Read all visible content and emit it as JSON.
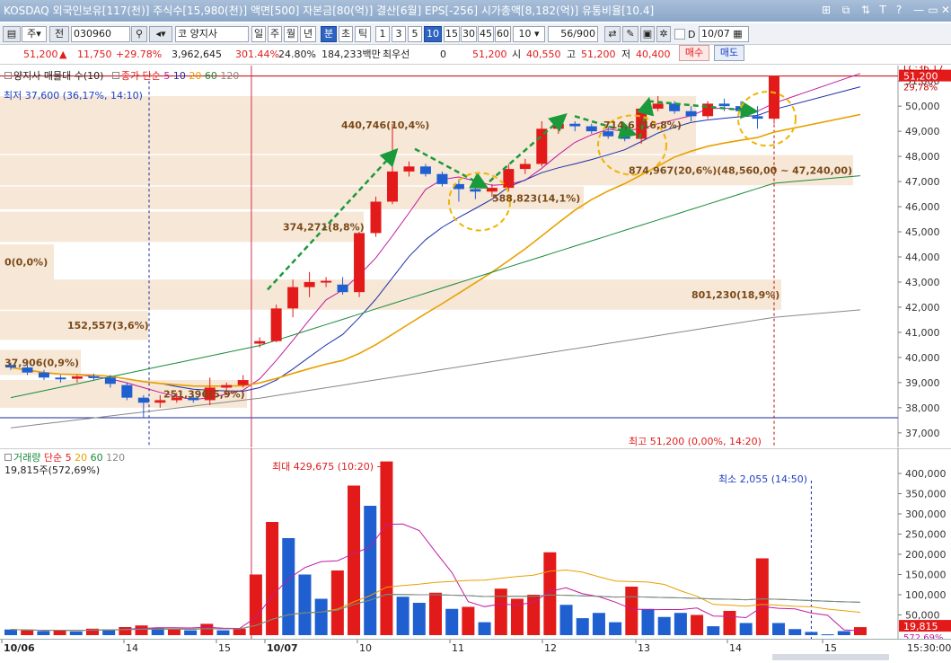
{
  "titlebar": {
    "text": "KOSDAQ 외국인보유[117(천)] 주식수[15,980(천)] 액면[500] 자본금[80(억)] 결산[6월] EPS[-256] 시가총액[8,182(억)] 유통비율[10.4]",
    "buttons": [
      "⊞",
      "⧉",
      "⇅",
      "T",
      "?",
      "—",
      "▭",
      "✕"
    ]
  },
  "toolbar": {
    "period_select": "주",
    "prev_label": "전",
    "code": "030960",
    "market": "코",
    "stock_name": "양지사",
    "period_tabs": [
      "일",
      "주",
      "월",
      "년",
      "분",
      "초",
      "틱"
    ],
    "interval_tabs": [
      "1",
      "3",
      "5",
      "10",
      "15",
      "30",
      "45",
      "60"
    ],
    "selected_interval": "10",
    "selected_period": "분",
    "count_select": "10",
    "view_count": "56",
    "view_total": "/900",
    "date_label": "D",
    "date_value": "10/07"
  },
  "quote": {
    "price": "51,200",
    "change": "11,750",
    "change_pct": "+29.78%",
    "volume": "3,962,645",
    "volume_ratio": "301.44%",
    "turnover": "24.80%",
    "amount": "184,233백만",
    "priority_label": "최우선",
    "priority_value": "0",
    "priority_price": "51,200",
    "open_label": "시",
    "open": "40,550",
    "high_label": "고",
    "high": "51,200",
    "low_label": "저",
    "low": "40,400",
    "buy_label": "매수",
    "sell_label": "매도"
  },
  "price_legend": {
    "mf": "양지사 매물대 수(10)",
    "ma_title": "종가 단순",
    "ma_periods": [
      "5",
      "10",
      "20",
      "60",
      "120"
    ],
    "ma_colors": [
      "#c01ba0",
      "#1c2fa8",
      "#e8a000",
      "#1a8a3a",
      "#888888"
    ],
    "low_note": "최저 37,600 (36,17%, 14:10)",
    "high_note": "최고 51,200 (0,00%, 14:20)",
    "lc_label": "LC:36,17",
    "last_price_tag": "51,200",
    "pct_tag": "29,78%"
  },
  "volume_profile": [
    {
      "label": "440,746(10,4%)"
    },
    {
      "label": "714,6 (16,8%)"
    },
    {
      "label": "874,967(20,6%)(48,560,00 ~ 47,240,00)"
    },
    {
      "label": "588,823(14,1%)"
    },
    {
      "label": "374,271(8,8%)"
    },
    {
      "label": "0(0,0%)"
    },
    {
      "label": "801,230(18,9%)"
    },
    {
      "label": "152,557(3,6%)"
    },
    {
      "label": "37,906(0,9%)"
    },
    {
      "label": "251,396(5,9%)"
    }
  ],
  "price_axis": {
    "ticks": [
      "51,000",
      "50,000",
      "49,000",
      "48,000",
      "47,000",
      "46,000",
      "45,000",
      "44,000",
      "43,000",
      "42,000",
      "41,000",
      "40,000",
      "39,000",
      "38,000",
      "37,000"
    ]
  },
  "volume_legend": {
    "title": "거래량",
    "ma_title": "단순",
    "ma_periods": [
      "5",
      "20",
      "60",
      "120"
    ],
    "current": "19,815주(572,69%)",
    "max_note": "최대 429,675 (10:20)",
    "min_note": "최소 2,055 (14:50)",
    "last_tag": "19,815",
    "pct_tag": "572,69%"
  },
  "volume_axis": {
    "ticks": [
      "400,000",
      "350,000",
      "300,000",
      "250,000",
      "200,000",
      "150,000",
      "100,000",
      "50,000"
    ]
  },
  "x_axis": {
    "labels": [
      "10/06",
      "14",
      "15",
      "10/07",
      "10",
      "11",
      "12",
      "13",
      "14",
      "15",
      "15:30:00"
    ]
  },
  "chart_data": {
    "type": "candlestick",
    "unit": "KRW",
    "interval": "10min",
    "ylim": [
      36600,
      51400
    ],
    "candles": [
      {
        "o": 39700,
        "h": 39800,
        "l": 39500,
        "c": 39600
      },
      {
        "o": 39600,
        "h": 39700,
        "l": 39300,
        "c": 39400
      },
      {
        "o": 39400,
        "h": 39500,
        "l": 39100,
        "c": 39200
      },
      {
        "o": 39200,
        "h": 39300,
        "l": 39000,
        "c": 39150
      },
      {
        "o": 39150,
        "h": 39300,
        "l": 39000,
        "c": 39250
      },
      {
        "o": 39250,
        "h": 39350,
        "l": 39100,
        "c": 39200
      },
      {
        "o": 39200,
        "h": 39300,
        "l": 38800,
        "c": 38950
      },
      {
        "o": 38900,
        "h": 39000,
        "l": 38300,
        "c": 38400
      },
      {
        "o": 38400,
        "h": 38500,
        "l": 37600,
        "c": 38200
      },
      {
        "o": 38200,
        "h": 38500,
        "l": 38000,
        "c": 38300
      },
      {
        "o": 38300,
        "h": 38600,
        "l": 38200,
        "c": 38400
      },
      {
        "o": 38400,
        "h": 38500,
        "l": 38200,
        "c": 38300
      },
      {
        "o": 38300,
        "h": 39200,
        "l": 38100,
        "c": 38800
      },
      {
        "o": 38800,
        "h": 39000,
        "l": 38500,
        "c": 38900
      },
      {
        "o": 38900,
        "h": 39300,
        "l": 38800,
        "c": 39100
      },
      {
        "o": 40550,
        "h": 40800,
        "l": 40400,
        "c": 40650
      },
      {
        "o": 40650,
        "h": 42100,
        "l": 40600,
        "c": 41950
      },
      {
        "o": 41950,
        "h": 43100,
        "l": 41600,
        "c": 42800
      },
      {
        "o": 42800,
        "h": 43400,
        "l": 42400,
        "c": 43000
      },
      {
        "o": 43000,
        "h": 43200,
        "l": 42800,
        "c": 43050
      },
      {
        "o": 42900,
        "h": 43200,
        "l": 42500,
        "c": 42600
      },
      {
        "o": 42600,
        "h": 45000,
        "l": 42400,
        "c": 44950
      },
      {
        "o": 44950,
        "h": 46400,
        "l": 44800,
        "c": 46200
      },
      {
        "o": 46200,
        "h": 49300,
        "l": 46100,
        "c": 47400
      },
      {
        "o": 47400,
        "h": 47800,
        "l": 47200,
        "c": 47600
      },
      {
        "o": 47600,
        "h": 47700,
        "l": 47200,
        "c": 47300
      },
      {
        "o": 47300,
        "h": 47400,
        "l": 46800,
        "c": 46900
      },
      {
        "o": 46900,
        "h": 47100,
        "l": 46200,
        "c": 46700
      },
      {
        "o": 46700,
        "h": 47200,
        "l": 46300,
        "c": 46600
      },
      {
        "o": 46600,
        "h": 46900,
        "l": 46400,
        "c": 46750
      },
      {
        "o": 46750,
        "h": 47700,
        "l": 46600,
        "c": 47500
      },
      {
        "o": 47500,
        "h": 47900,
        "l": 47300,
        "c": 47700
      },
      {
        "o": 47700,
        "h": 49400,
        "l": 47600,
        "c": 49100
      },
      {
        "o": 49100,
        "h": 49500,
        "l": 48900,
        "c": 49300
      },
      {
        "o": 49300,
        "h": 49400,
        "l": 49000,
        "c": 49200
      },
      {
        "o": 49200,
        "h": 49300,
        "l": 48900,
        "c": 49000
      },
      {
        "o": 49000,
        "h": 49200,
        "l": 48700,
        "c": 48800
      },
      {
        "o": 48800,
        "h": 49000,
        "l": 48600,
        "c": 48700
      },
      {
        "o": 48700,
        "h": 49800,
        "l": 48500,
        "c": 49900
      },
      {
        "o": 49900,
        "h": 50400,
        "l": 49800,
        "c": 50100
      },
      {
        "o": 50100,
        "h": 50200,
        "l": 49700,
        "c": 49800
      },
      {
        "o": 49800,
        "h": 50000,
        "l": 49400,
        "c": 49600
      },
      {
        "o": 49600,
        "h": 50200,
        "l": 49500,
        "c": 50100
      },
      {
        "o": 50100,
        "h": 50300,
        "l": 49800,
        "c": 50000
      },
      {
        "o": 50000,
        "h": 50200,
        "l": 49600,
        "c": 49800
      },
      {
        "o": 49600,
        "h": 50000,
        "l": 49100,
        "c": 49500
      },
      {
        "o": 49500,
        "h": 51200,
        "l": 49300,
        "c": 51200
      }
    ],
    "volumes": [
      {
        "v": 14000,
        "up": false
      },
      {
        "v": 12000,
        "up": true
      },
      {
        "v": 10000,
        "up": false
      },
      {
        "v": 13000,
        "up": true
      },
      {
        "v": 9000,
        "up": false
      },
      {
        "v": 16000,
        "up": true
      },
      {
        "v": 14000,
        "up": false
      },
      {
        "v": 20000,
        "up": true
      },
      {
        "v": 24000,
        "up": true
      },
      {
        "v": 18000,
        "up": false
      },
      {
        "v": 15000,
        "up": true
      },
      {
        "v": 12000,
        "up": false
      },
      {
        "v": 28000,
        "up": true
      },
      {
        "v": 12000,
        "up": false
      },
      {
        "v": 16000,
        "up": true
      },
      {
        "v": 150000,
        "up": true
      },
      {
        "v": 280000,
        "up": true
      },
      {
        "v": 240000,
        "up": false
      },
      {
        "v": 150000,
        "up": false
      },
      {
        "v": 90000,
        "up": false
      },
      {
        "v": 160000,
        "up": true
      },
      {
        "v": 370000,
        "up": true
      },
      {
        "v": 320000,
        "up": false
      },
      {
        "v": 429675,
        "up": true
      },
      {
        "v": 95000,
        "up": false
      },
      {
        "v": 80000,
        "up": false
      },
      {
        "v": 105000,
        "up": true
      },
      {
        "v": 65000,
        "up": false
      },
      {
        "v": 70000,
        "up": true
      },
      {
        "v": 32000,
        "up": false
      },
      {
        "v": 115000,
        "up": true
      },
      {
        "v": 90000,
        "up": true
      },
      {
        "v": 100000,
        "up": true
      },
      {
        "v": 205000,
        "up": true
      },
      {
        "v": 75000,
        "up": false
      },
      {
        "v": 42000,
        "up": false
      },
      {
        "v": 55000,
        "up": false
      },
      {
        "v": 32000,
        "up": false
      },
      {
        "v": 120000,
        "up": true
      },
      {
        "v": 65000,
        "up": false
      },
      {
        "v": 45000,
        "up": false
      },
      {
        "v": 55000,
        "up": false
      },
      {
        "v": 50000,
        "up": true
      },
      {
        "v": 22000,
        "up": false
      },
      {
        "v": 60000,
        "up": true
      },
      {
        "v": 30000,
        "up": false
      },
      {
        "v": 190000,
        "up": true
      },
      {
        "v": 30000,
        "up": false
      },
      {
        "v": 15000,
        "up": false
      },
      {
        "v": 8000,
        "up": false
      },
      {
        "v": 2055,
        "up": false
      },
      {
        "v": 10000,
        "up": false
      },
      {
        "v": 19815,
        "up": true
      }
    ],
    "vol_ylim": [
      0,
      440000
    ]
  }
}
